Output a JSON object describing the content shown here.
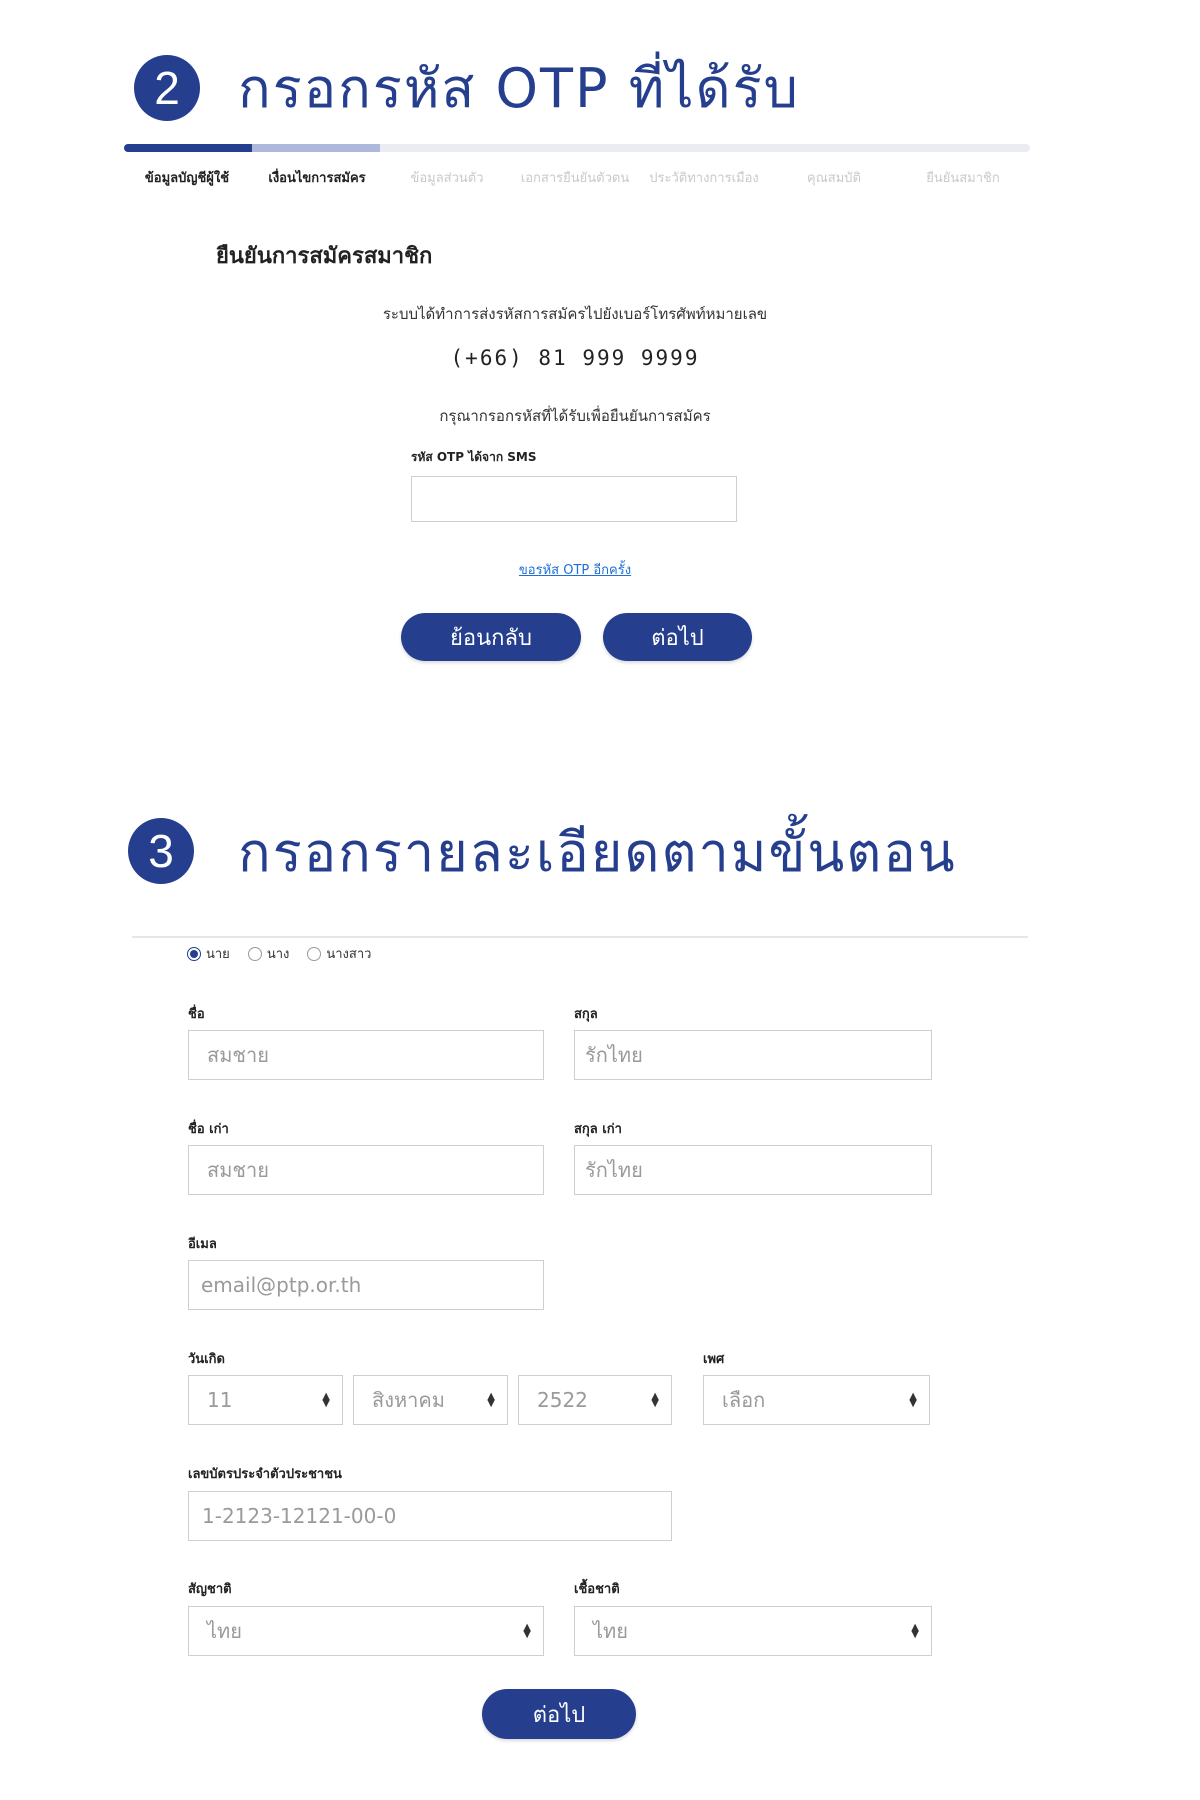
{
  "section_otp": {
    "number": "2",
    "heading": "กรอกรหัส OTP ที่ได้รับ",
    "progress": {
      "completed_steps": 1,
      "current_step": 2,
      "total_steps": 7
    },
    "steps": [
      {
        "label": "ข้อมูลบัญชีผู้ใช้"
      },
      {
        "label": "เงื่อนไขการสมัคร"
      },
      {
        "label": "ข้อมูลส่วนตัว"
      },
      {
        "label": "เอกสารยืนยันตัวตน"
      },
      {
        "label": "ประวัติทางการเมือง"
      },
      {
        "label": "คุณสมบัติ"
      },
      {
        "label": "ยืนยันสมาชิก"
      }
    ],
    "card_title": "ยืนยันการสมัครสมาชิก",
    "message": "ระบบได้ทำการส่งรหัสการสมัครไปยังเบอร์โทรศัพท์หมายเลข",
    "phone": "(+66) 81 999 9999",
    "instruction": "กรุณากรอกรหัสที่ได้รับเพื่อยืนยันการสมัคร",
    "otp_label": "รหัส OTP ได้จาก SMS",
    "otp_value": "",
    "resend_label": "ขอรหัส OTP อีกครั้ง",
    "back_label": "ย้อนกลับ",
    "next_label": "ต่อไป"
  },
  "section_form": {
    "number": "3",
    "heading": "กรอกรายละเอียดตามขั้นตอน",
    "titles": [
      {
        "label": "นาย",
        "checked": true
      },
      {
        "label": "นาง",
        "checked": false
      },
      {
        "label": "นางสาว",
        "checked": false
      }
    ],
    "first_name": {
      "label": "ชื่อ",
      "placeholder": "สมชาย"
    },
    "last_name": {
      "label": "สกุล",
      "placeholder": "รักไทย"
    },
    "old_first_name": {
      "label": "ชื่อ เก่า",
      "placeholder": "สมชาย"
    },
    "old_last_name": {
      "label": "สกุล เก่า",
      "placeholder": "รักไทย"
    },
    "email": {
      "label": "อีเมล",
      "placeholder": "email@ptp.or.th"
    },
    "birthdate": {
      "label": "วันเกิด",
      "day": "11",
      "month": "สิงหาคม",
      "year": "2522"
    },
    "gender": {
      "label": "เพศ",
      "value": "เลือก"
    },
    "id_card": {
      "label": "เลขบัตรประจำตัวประชาชน",
      "placeholder": "1-2123-12121-00-0"
    },
    "nationality": {
      "label": "สัญชาติ",
      "value": "ไทย"
    },
    "ethnicity": {
      "label": "เชื้อชาติ",
      "value": "ไทย"
    },
    "next_label": "ต่อไป"
  }
}
